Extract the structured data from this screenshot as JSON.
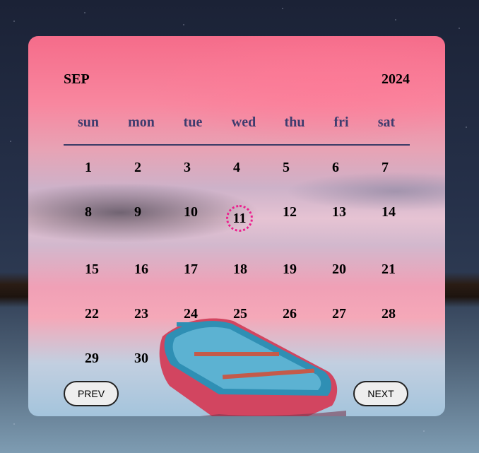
{
  "calendar": {
    "month": "SEP",
    "year": "2024",
    "weekdays": [
      "sun",
      "mon",
      "tue",
      "wed",
      "thu",
      "fri",
      "sat"
    ],
    "today": "11",
    "weeks": [
      [
        "1",
        "2",
        "3",
        "4",
        "5",
        "6",
        "7"
      ],
      [
        "8",
        "9",
        "10",
        "11",
        "12",
        "13",
        "14"
      ],
      [
        "15",
        "16",
        "17",
        "18",
        "19",
        "20",
        "21"
      ],
      [
        "22",
        "23",
        "24",
        "25",
        "26",
        "27",
        "28"
      ],
      [
        "29",
        "30",
        "",
        "",
        "",
        "",
        ""
      ]
    ]
  },
  "buttons": {
    "prev": "PREV",
    "next": "NEXT"
  },
  "colors": {
    "weekday_text": "#3f3c6e",
    "today_ring": "#ec1f8e",
    "button_bg": "#eeeeee"
  }
}
